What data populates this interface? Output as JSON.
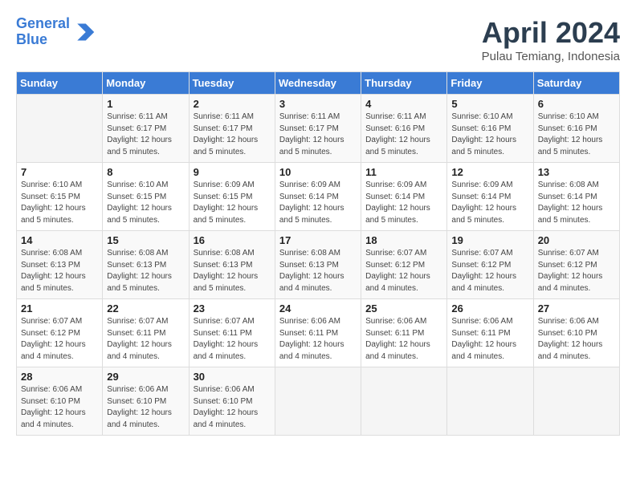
{
  "header": {
    "logo_line1": "General",
    "logo_line2": "Blue",
    "month_title": "April 2024",
    "location": "Pulau Temiang, Indonesia"
  },
  "weekdays": [
    "Sunday",
    "Monday",
    "Tuesday",
    "Wednesday",
    "Thursday",
    "Friday",
    "Saturday"
  ],
  "weeks": [
    [
      {
        "day": "",
        "info": ""
      },
      {
        "day": "1",
        "info": "Sunrise: 6:11 AM\nSunset: 6:17 PM\nDaylight: 12 hours\nand 5 minutes."
      },
      {
        "day": "2",
        "info": "Sunrise: 6:11 AM\nSunset: 6:17 PM\nDaylight: 12 hours\nand 5 minutes."
      },
      {
        "day": "3",
        "info": "Sunrise: 6:11 AM\nSunset: 6:17 PM\nDaylight: 12 hours\nand 5 minutes."
      },
      {
        "day": "4",
        "info": "Sunrise: 6:11 AM\nSunset: 6:16 PM\nDaylight: 12 hours\nand 5 minutes."
      },
      {
        "day": "5",
        "info": "Sunrise: 6:10 AM\nSunset: 6:16 PM\nDaylight: 12 hours\nand 5 minutes."
      },
      {
        "day": "6",
        "info": "Sunrise: 6:10 AM\nSunset: 6:16 PM\nDaylight: 12 hours\nand 5 minutes."
      }
    ],
    [
      {
        "day": "7",
        "info": "Sunrise: 6:10 AM\nSunset: 6:15 PM\nDaylight: 12 hours\nand 5 minutes."
      },
      {
        "day": "8",
        "info": "Sunrise: 6:10 AM\nSunset: 6:15 PM\nDaylight: 12 hours\nand 5 minutes."
      },
      {
        "day": "9",
        "info": "Sunrise: 6:09 AM\nSunset: 6:15 PM\nDaylight: 12 hours\nand 5 minutes."
      },
      {
        "day": "10",
        "info": "Sunrise: 6:09 AM\nSunset: 6:14 PM\nDaylight: 12 hours\nand 5 minutes."
      },
      {
        "day": "11",
        "info": "Sunrise: 6:09 AM\nSunset: 6:14 PM\nDaylight: 12 hours\nand 5 minutes."
      },
      {
        "day": "12",
        "info": "Sunrise: 6:09 AM\nSunset: 6:14 PM\nDaylight: 12 hours\nand 5 minutes."
      },
      {
        "day": "13",
        "info": "Sunrise: 6:08 AM\nSunset: 6:14 PM\nDaylight: 12 hours\nand 5 minutes."
      }
    ],
    [
      {
        "day": "14",
        "info": "Sunrise: 6:08 AM\nSunset: 6:13 PM\nDaylight: 12 hours\nand 5 minutes."
      },
      {
        "day": "15",
        "info": "Sunrise: 6:08 AM\nSunset: 6:13 PM\nDaylight: 12 hours\nand 5 minutes."
      },
      {
        "day": "16",
        "info": "Sunrise: 6:08 AM\nSunset: 6:13 PM\nDaylight: 12 hours\nand 5 minutes."
      },
      {
        "day": "17",
        "info": "Sunrise: 6:08 AM\nSunset: 6:13 PM\nDaylight: 12 hours\nand 4 minutes."
      },
      {
        "day": "18",
        "info": "Sunrise: 6:07 AM\nSunset: 6:12 PM\nDaylight: 12 hours\nand 4 minutes."
      },
      {
        "day": "19",
        "info": "Sunrise: 6:07 AM\nSunset: 6:12 PM\nDaylight: 12 hours\nand 4 minutes."
      },
      {
        "day": "20",
        "info": "Sunrise: 6:07 AM\nSunset: 6:12 PM\nDaylight: 12 hours\nand 4 minutes."
      }
    ],
    [
      {
        "day": "21",
        "info": "Sunrise: 6:07 AM\nSunset: 6:12 PM\nDaylight: 12 hours\nand 4 minutes."
      },
      {
        "day": "22",
        "info": "Sunrise: 6:07 AM\nSunset: 6:11 PM\nDaylight: 12 hours\nand 4 minutes."
      },
      {
        "day": "23",
        "info": "Sunrise: 6:07 AM\nSunset: 6:11 PM\nDaylight: 12 hours\nand 4 minutes."
      },
      {
        "day": "24",
        "info": "Sunrise: 6:06 AM\nSunset: 6:11 PM\nDaylight: 12 hours\nand 4 minutes."
      },
      {
        "day": "25",
        "info": "Sunrise: 6:06 AM\nSunset: 6:11 PM\nDaylight: 12 hours\nand 4 minutes."
      },
      {
        "day": "26",
        "info": "Sunrise: 6:06 AM\nSunset: 6:11 PM\nDaylight: 12 hours\nand 4 minutes."
      },
      {
        "day": "27",
        "info": "Sunrise: 6:06 AM\nSunset: 6:10 PM\nDaylight: 12 hours\nand 4 minutes."
      }
    ],
    [
      {
        "day": "28",
        "info": "Sunrise: 6:06 AM\nSunset: 6:10 PM\nDaylight: 12 hours\nand 4 minutes."
      },
      {
        "day": "29",
        "info": "Sunrise: 6:06 AM\nSunset: 6:10 PM\nDaylight: 12 hours\nand 4 minutes."
      },
      {
        "day": "30",
        "info": "Sunrise: 6:06 AM\nSunset: 6:10 PM\nDaylight: 12 hours\nand 4 minutes."
      },
      {
        "day": "",
        "info": ""
      },
      {
        "day": "",
        "info": ""
      },
      {
        "day": "",
        "info": ""
      },
      {
        "day": "",
        "info": ""
      }
    ]
  ]
}
